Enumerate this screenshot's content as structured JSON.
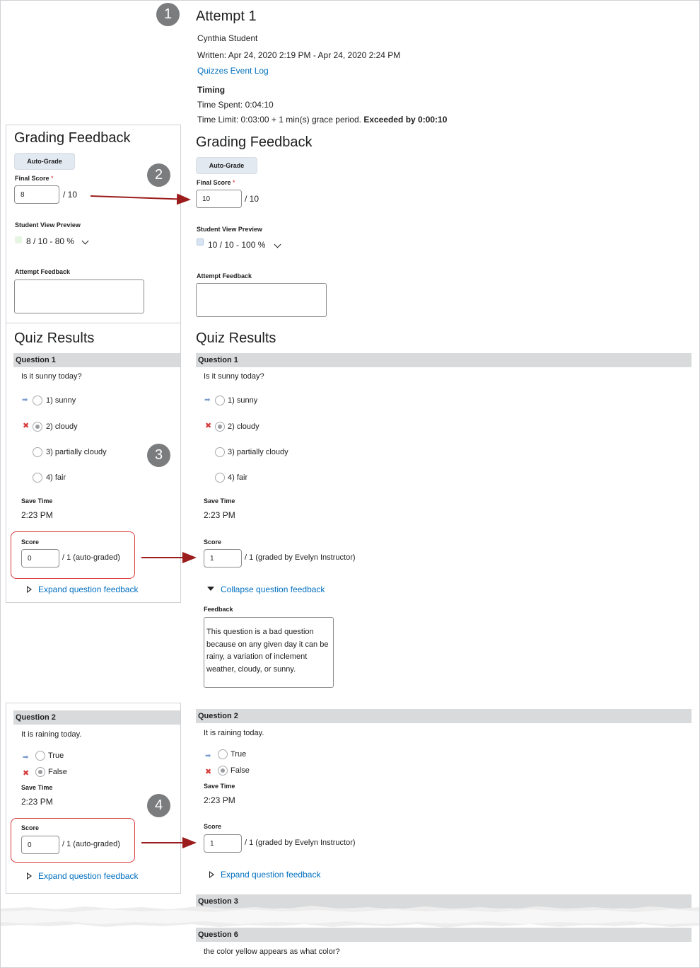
{
  "attempt": {
    "title": "Attempt 1",
    "student": "Cynthia Student",
    "written": "Written: Apr 24, 2020 2:19 PM - Apr 24, 2020 2:24 PM",
    "event_log_link": "Quizzes Event Log",
    "timing_heading": "Timing",
    "time_spent": "Time Spent: 0:04:10",
    "time_limit": "Time Limit: 0:03:00 + 1 min(s) grace period.",
    "exceeded": "Exceeded by 0:00:10"
  },
  "badges": [
    "1",
    "2",
    "3",
    "4"
  ],
  "left": {
    "grading": {
      "title": "Grading Feedback",
      "auto_grade": "Auto-Grade",
      "final_score_label": "Final Score",
      "required_mark": "*",
      "final_score_value": "8",
      "final_score_out_of": "/ 10",
      "preview_label": "Student View Preview",
      "preview_value": "8 / 10 - 80 %",
      "preview_color": "#e6f4e2",
      "attempt_feedback_label": "Attempt Feedback"
    },
    "quiz_results_title": "Quiz Results",
    "q1": {
      "header": "Question 1",
      "text": "Is it sunny today?",
      "options": [
        "1)  sunny",
        "2)  cloudy",
        "3)  partially cloudy",
        "4)  fair"
      ],
      "save_time_label": "Save Time",
      "save_time": "2:23 PM",
      "score_label": "Score",
      "score_value": "0",
      "score_suffix": "/ 1  (auto-graded)",
      "expand": "Expand question feedback"
    },
    "q2": {
      "header": "Question 2",
      "text": "It is raining today.",
      "options": [
        "True",
        "False"
      ],
      "save_time_label": "Save Time",
      "save_time": "2:23 PM",
      "score_label": "Score",
      "score_value": "0",
      "score_suffix": "/ 1  (auto-graded)",
      "expand": "Expand question feedback"
    }
  },
  "right": {
    "grading": {
      "title": "Grading Feedback",
      "auto_grade": "Auto-Grade",
      "final_score_label": "Final Score",
      "required_mark": "*",
      "final_score_value": "10",
      "final_score_out_of": "/ 10",
      "preview_label": "Student View Preview",
      "preview_value": "10 / 10 - 100 %",
      "preview_color": "#d6e4f3",
      "attempt_feedback_label": "Attempt Feedback"
    },
    "quiz_results_title": "Quiz Results",
    "q1": {
      "header": "Question 1",
      "text": "Is it sunny today?",
      "options": [
        "1)  sunny",
        "2)  cloudy",
        "3)  partially cloudy",
        "4)  fair"
      ],
      "save_time_label": "Save Time",
      "save_time": "2:23 PM",
      "score_label": "Score",
      "score_value": "1",
      "score_suffix": "/ 1  (graded by  Evelyn Instructor)",
      "collapse": "Collapse question feedback",
      "feedback_label": "Feedback",
      "feedback_text": "This question is a bad question because on any given day it can be rainy, a variation of inclement weather, cloudy, or sunny."
    },
    "q2": {
      "header": "Question 2",
      "text": "It is raining today.",
      "options": [
        "True",
        "False"
      ],
      "save_time_label": "Save Time",
      "save_time": "2:23 PM",
      "score_label": "Score",
      "score_value": "1",
      "score_suffix": "/ 1  (graded by  Evelyn Instructor)",
      "expand": "Expand question feedback"
    },
    "q3": {
      "header": "Question 3"
    },
    "q6": {
      "header": "Question 6",
      "text": "the color yellow appears as what color?"
    }
  },
  "colors": {
    "link": "#006fbf",
    "annotation_arrow": "#9b1c1c",
    "highlight_box": "#d83a3a",
    "badge": "#7b7c7e",
    "question_bar": "#d9dadb"
  }
}
